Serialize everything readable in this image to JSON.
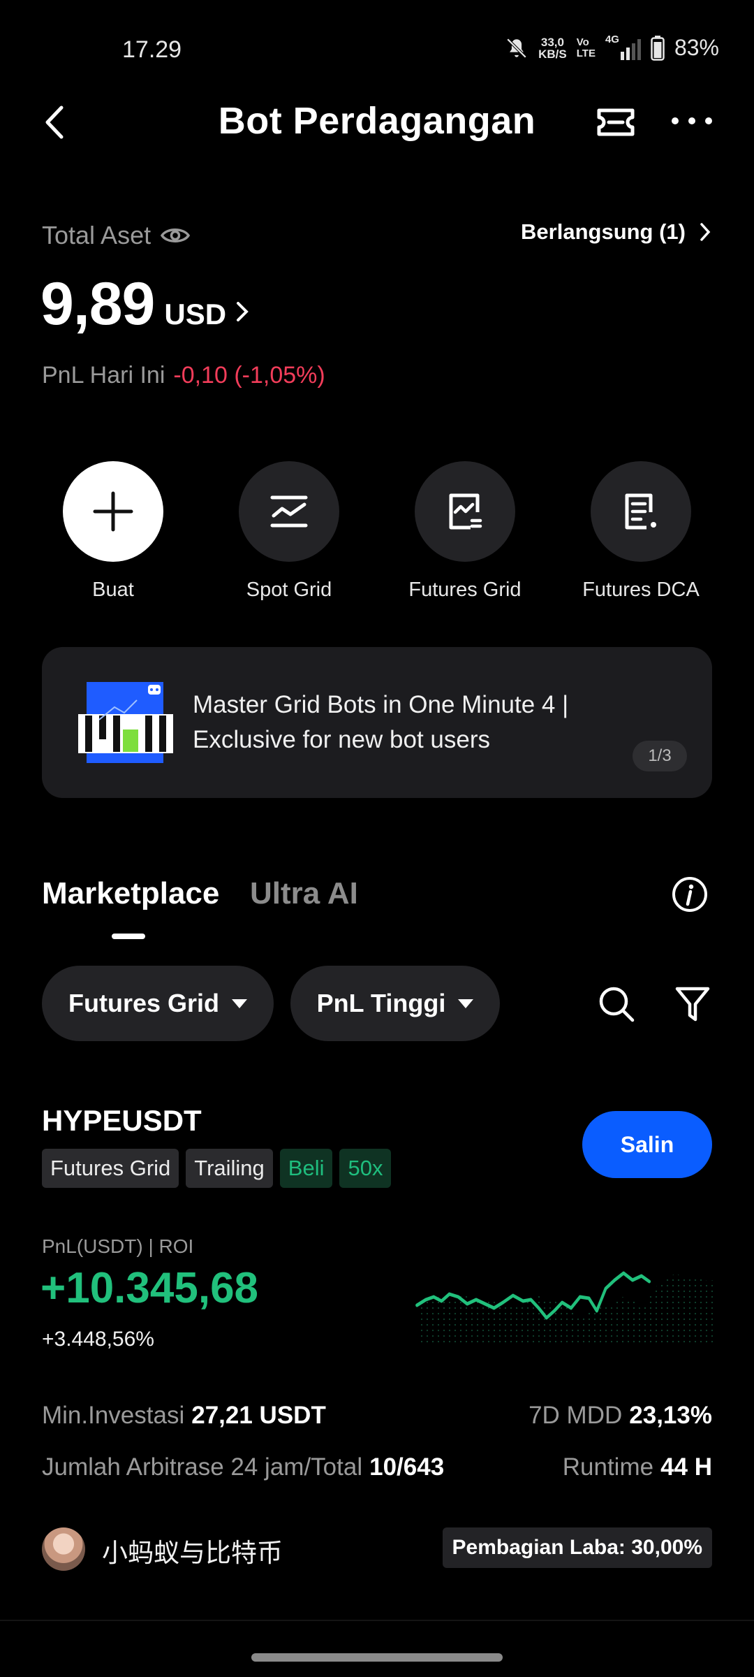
{
  "status_bar": {
    "time": "17.29",
    "net_speed": "33,0",
    "net_unit": "KB/S",
    "volte_top": "Vo",
    "volte_bottom": "LTE",
    "network": "4G",
    "battery": "83%"
  },
  "header": {
    "title": "Bot Perdagangan"
  },
  "assets": {
    "total_label": "Total Aset",
    "running_label": "Berlangsung (1)",
    "amount": "9,89",
    "currency": "USD",
    "pnl_label": "PnL Hari Ini",
    "pnl_value": "-0,10 (-1,05%)"
  },
  "quick_actions": [
    {
      "label": "Buat",
      "icon": "plus-icon"
    },
    {
      "label": "Spot Grid",
      "icon": "spot-grid-icon"
    },
    {
      "label": "Futures Grid",
      "icon": "futures-grid-icon"
    },
    {
      "label": "Futures DCA",
      "icon": "futures-dca-icon"
    }
  ],
  "banner": {
    "text": "Master Grid Bots in One Minute 4 | Exclusive for new bot users",
    "pager": "1/3"
  },
  "tabs": {
    "marketplace": "Marketplace",
    "ultra_ai": "Ultra AI"
  },
  "filters": {
    "type": "Futures Grid",
    "sort": "PnL Tinggi"
  },
  "bot": {
    "pair": "HYPEUSDT",
    "tags": [
      "Futures Grid",
      "Trailing",
      "Beli",
      "50x"
    ],
    "copy_label": "Salin",
    "pnl_label": "PnL(USDT) | ROI",
    "pnl_value": "+10.345,68",
    "roi_value": "+3.448,56%",
    "min_invest_label": "Min.Investasi",
    "min_invest_value": "27,21 USDT",
    "mdd_label": "7D MDD",
    "mdd_value": "23,13%",
    "arb_label": "Jumlah Arbitrase 24 jam/Total",
    "arb_value": "10/643",
    "runtime_label": "Runtime",
    "runtime_value": "44 H",
    "creator": "小蚂蚁与比特币",
    "profit_share": "Pembagian Laba: 30,00%"
  },
  "colors": {
    "accent_blue": "#0a5dff",
    "positive_green": "#21c07c",
    "negative_red": "#f23d5a"
  }
}
